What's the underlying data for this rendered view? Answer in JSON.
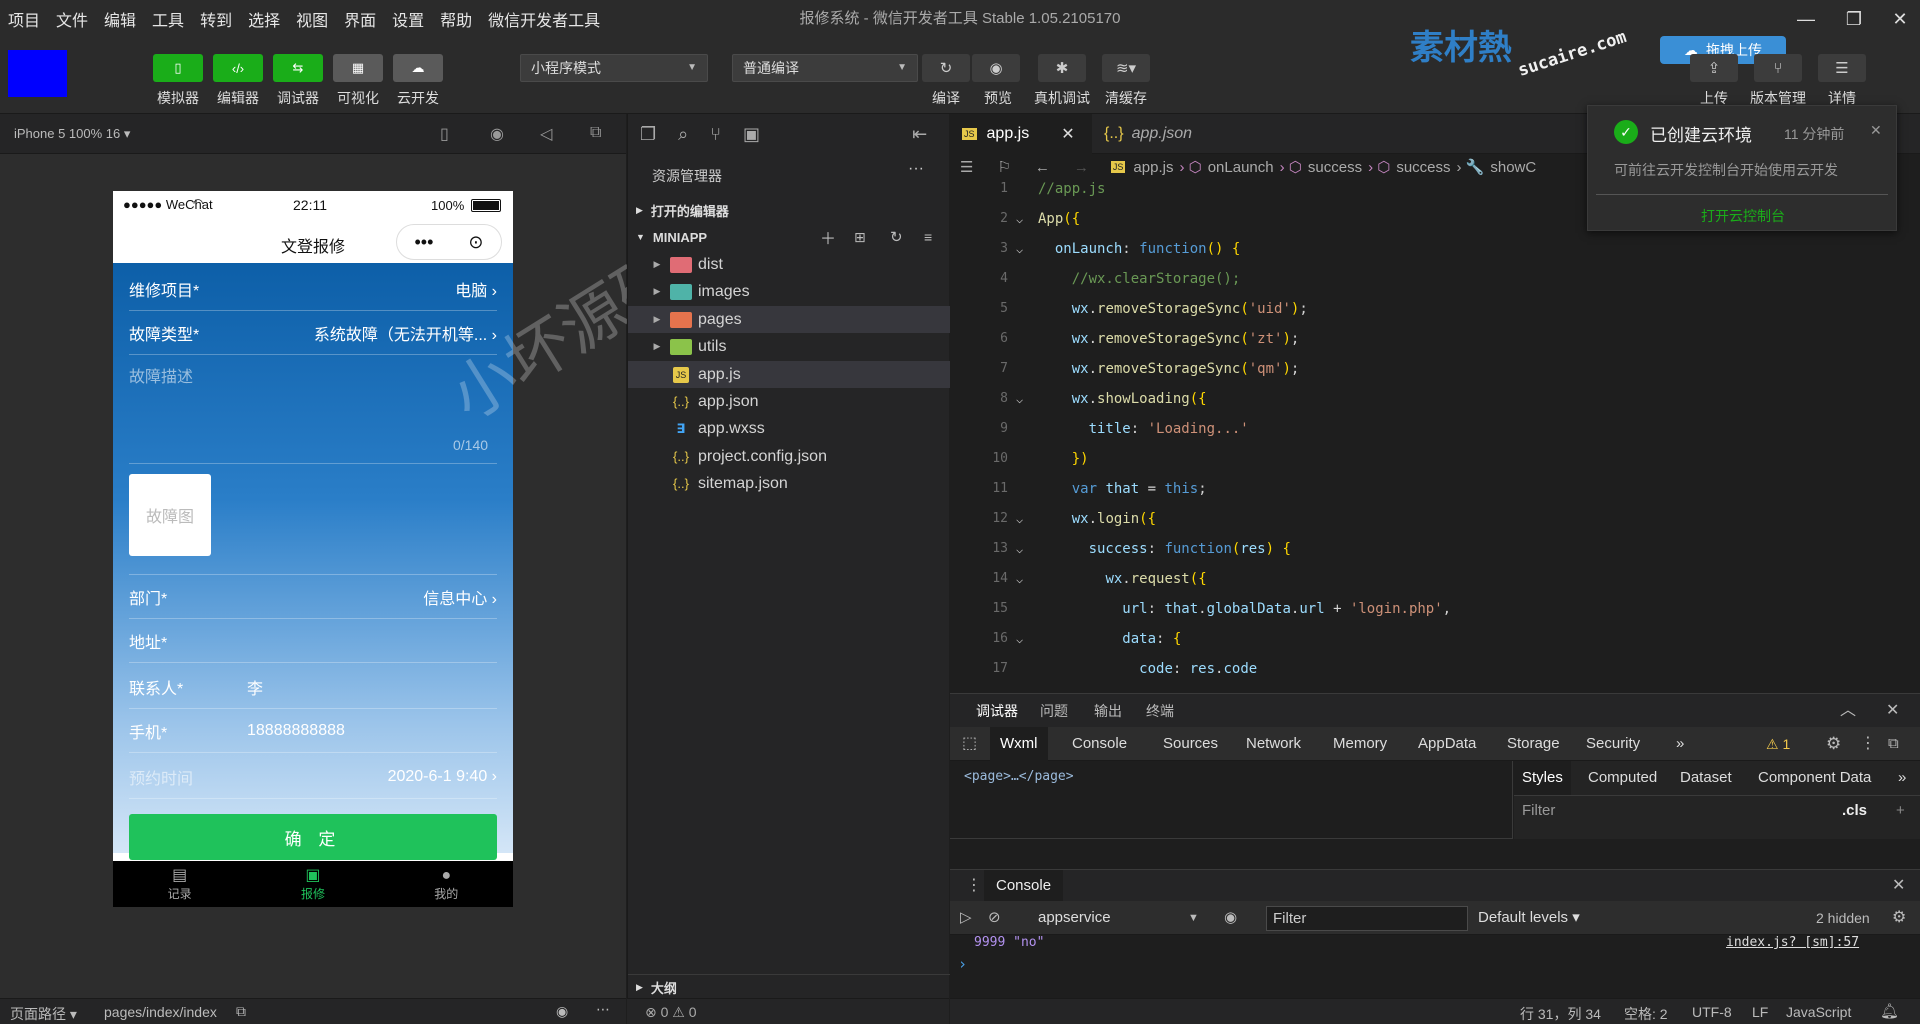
{
  "menu": {
    "items": [
      "项目",
      "文件",
      "编辑",
      "工具",
      "转到",
      "选择",
      "视图",
      "界面",
      "设置",
      "帮助",
      "微信开发者工具"
    ],
    "window_title": "报修系统 - 微信开发者工具 Stable 1.05.2105170"
  },
  "toolbar": {
    "left_buttons": [
      {
        "label": "模拟器",
        "icon": "phone-icon",
        "color": "green"
      },
      {
        "label": "编辑器",
        "icon": "code-icon",
        "color": "green"
      },
      {
        "label": "调试器",
        "icon": "debugger-icon",
        "color": "green"
      },
      {
        "label": "可视化",
        "icon": "layout-icon",
        "color": "gray"
      },
      {
        "label": "云开发",
        "icon": "cloud-icon",
        "color": "gray"
      }
    ],
    "mode_select": "小程序模式",
    "compile_select": "普通编译",
    "mid_buttons": [
      {
        "label": "编译",
        "icon": "refresh-icon"
      },
      {
        "label": "预览",
        "icon": "eye-icon"
      },
      {
        "label": "真机调试",
        "icon": "bug-icon"
      },
      {
        "label": "清缓存",
        "icon": "layers-icon"
      }
    ],
    "right_buttons": [
      {
        "label": "上传",
        "icon": "upload-icon"
      },
      {
        "label": "版本管理",
        "icon": "branch-icon"
      },
      {
        "label": "详情",
        "icon": "menu-icon"
      }
    ],
    "drag_upload": "拖拽上传",
    "logo_text": "素材熱",
    "logo_sub": "sucaire.com"
  },
  "simulator": {
    "device": "iPhone 5 100% 16 ▾",
    "status": {
      "carrier": "●●●●● WeChat",
      "time": "22:11",
      "battery": "100%"
    },
    "nav_title": "文登报修",
    "form": {
      "project_label": "维修项目*",
      "project_value": "电脑",
      "fault_label": "故障类型*",
      "fault_value": "系统故障（无法开机等...",
      "desc_placeholder": "故障描述",
      "counter": "0/140",
      "photo_label": "故障图",
      "dept_label": "部门*",
      "dept_value": "信息中心",
      "address_label": "地址*",
      "contact_label": "联系人*",
      "contact_value": "李",
      "phone_label": "手机*",
      "phone_value": "18888888888",
      "time_label": "预约时间",
      "time_value": "2020-6-1 9:40",
      "submit": "确 定"
    },
    "tabs": [
      {
        "label": "记录",
        "icon": "list-icon",
        "active": false
      },
      {
        "label": "报修",
        "icon": "toolbox-icon",
        "active": true
      },
      {
        "label": "我的",
        "icon": "user-icon",
        "active": false
      }
    ],
    "watermark": "小坏源码",
    "footer": {
      "path_label": "页面路径 ▾",
      "path": "pages/index/index"
    }
  },
  "explorer": {
    "title": "资源管理器",
    "open_editors": "打开的编辑器",
    "project": "MINIAPP",
    "items": [
      {
        "name": "dist",
        "type": "folder",
        "color": "#e06c75"
      },
      {
        "name": "images",
        "type": "folder",
        "color": "#4fb3a8"
      },
      {
        "name": "pages",
        "type": "folder",
        "color": "#e5734d"
      },
      {
        "name": "utils",
        "type": "folder",
        "color": "#8bc34a"
      },
      {
        "name": "app.js",
        "type": "js",
        "color": "#e6c84a"
      },
      {
        "name": "app.json",
        "type": "json",
        "color": "#e6c84a"
      },
      {
        "name": "app.wxss",
        "type": "css",
        "color": "#42a5f5"
      },
      {
        "name": "project.config.json",
        "type": "json",
        "color": "#e6c84a"
      },
      {
        "name": "sitemap.json",
        "type": "json",
        "color": "#e6c84a"
      }
    ],
    "outline": "大纲",
    "problems": "⊗ 0 ⚠ 0"
  },
  "editor": {
    "tabs": [
      "app.js",
      "app.json"
    ],
    "breadcrumb": [
      "app.js",
      "onLaunch",
      "success",
      "success",
      "showC"
    ],
    "lines": [
      "//app.js",
      "App({",
      "  onLaunch: function() {",
      "    //wx.clearStorage();",
      "    wx.removeStorageSync('uid');",
      "    wx.removeStorageSync('zt');",
      "    wx.removeStorageSync('qm');",
      "    wx.showLoading({",
      "      title: 'Loading...'",
      "    })",
      "    var that = this;",
      "    wx.login({",
      "      success: function(res) {",
      "        wx.request({",
      "          url: that.globalData.url + 'login.php',",
      "          data: {",
      "            code: res.code"
    ]
  },
  "notification": {
    "title": "已创建云环境",
    "time": "11 分钟前",
    "body": "可前往云开发控制台开始使用云开发",
    "action": "打开云控制台"
  },
  "devtools": {
    "top_tabs": [
      "调试器",
      "问题",
      "输出",
      "终端"
    ],
    "panels": [
      "Wxml",
      "Console",
      "Sources",
      "Network",
      "Memory",
      "AppData",
      "Storage",
      "Security",
      "»"
    ],
    "warnings": "⚠ 1",
    "wxml": "<page>…</page>",
    "style_tabs": [
      "Styles",
      "Computed",
      "Dataset",
      "Component Data",
      "»"
    ],
    "filter_placeholder": "Filter",
    "cls": ".cls",
    "console_title": "Console",
    "context": "appservice",
    "console_filter": "Filter",
    "levels": "Default levels ▾",
    "hidden": "2 hidden",
    "log_line": "9999 \"no\"",
    "log_source": "index.js? [sm]:57",
    "prompt": "›"
  },
  "statusbar": {
    "position": "行 31，列 34",
    "spaces": "空格: 2",
    "encoding": "UTF-8",
    "eol": "LF",
    "language": "JavaScript"
  }
}
